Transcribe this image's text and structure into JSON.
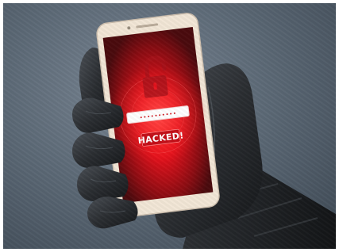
{
  "screen": {
    "password_mask": "••••••••••",
    "alert_label": "HACKED!"
  },
  "colors": {
    "background": "#5d6a77",
    "screen_red": "#e3111c",
    "glove": "#2a2d31",
    "phone_body": "#f2e6d6"
  },
  "icons": [
    "open-padlock-icon"
  ]
}
